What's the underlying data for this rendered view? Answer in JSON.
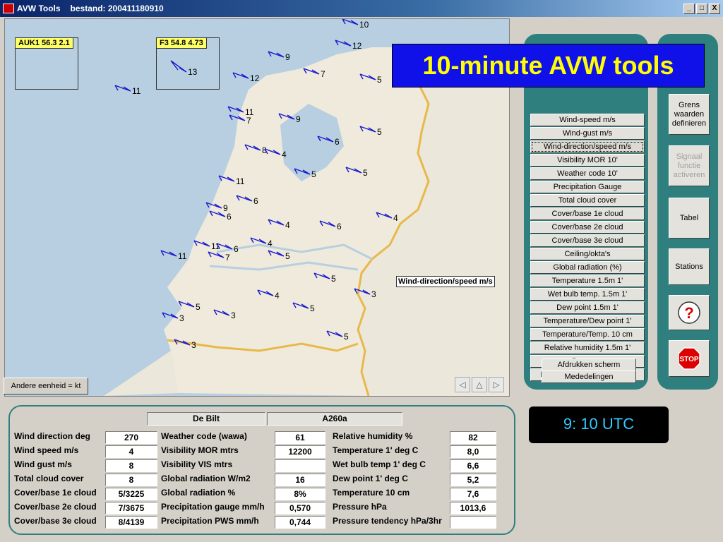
{
  "window": {
    "app_name": "AVW Tools",
    "subtitle": "bestand: 200411180910",
    "minimize": "_",
    "maximize": "□",
    "close": "X"
  },
  "banner": "10-minute AVW tools",
  "map": {
    "insets": [
      {
        "label": "AUK1 56.3 2.1"
      },
      {
        "label": "F3 54.8 4.73",
        "speed": "13"
      }
    ],
    "selected_parameter_label": "Wind-direction/speed m/s",
    "unit_button": "Andere eenheid = kt",
    "nav_buttons": [
      "◁",
      "△",
      "▷"
    ],
    "wind_speeds": [
      "10",
      "12",
      "9",
      "7",
      "5",
      "11",
      "12",
      "11",
      "7",
      "9",
      "6",
      "5",
      "8",
      "4",
      "11",
      "5",
      "5",
      "9",
      "6",
      "6",
      "4",
      "6",
      "4",
      "11",
      "11",
      "6",
      "7",
      "5",
      "4",
      "5",
      "3",
      "4",
      "5",
      "5",
      "3",
      "3",
      "5",
      "3"
    ]
  },
  "parameters": [
    "Wind-speed m/s",
    "Wind-gust m/s",
    "Wind-direction/speed m/s",
    "Visibility MOR 10'",
    "Weather code 10'",
    "Precipitation Gauge",
    "Total cloud cover",
    "Cover/base 1e cloud",
    "Cover/base 2e cloud",
    "Cover/base 3e cloud",
    "Ceiling/okta's",
    "Global radiation (%)",
    "Temperature 1.5m 1'",
    "Wet bulb temp. 1.5m 1'",
    "Dew point 1.5m 1'",
    "Temperature/Dew point 1'",
    "Temperature/Temp. 10 cm",
    "Relative humidity 1.5m 1'",
    "Pressure",
    "Pressure tendency hPa/3hr"
  ],
  "selected_parameter_index": 2,
  "bottom_buttons": [
    "Afdrukken scherm",
    "Mededelingen"
  ],
  "side_buttons": {
    "grens": "Grens\nwaarden\ndefinieren",
    "signaal": "Signaal\nfunctie\nactiveren",
    "tabel": "Tabel",
    "stations": "Stations",
    "help_glyph": "?",
    "stop_label": "STOP"
  },
  "clock": "9: 10 UTC",
  "station": {
    "name": "De Bilt",
    "code": "A260a"
  },
  "readings": {
    "col1": [
      {
        "label": "Wind direction deg",
        "value": "270"
      },
      {
        "label": "Wind speed m/s",
        "value": "4"
      },
      {
        "label": "Wind gust m/s",
        "value": "8"
      },
      {
        "label": "Total cloud cover",
        "value": "8"
      },
      {
        "label": "Cover/base 1e cloud",
        "value": "5/3225"
      },
      {
        "label": "Cover/base 2e cloud",
        "value": "7/3675"
      },
      {
        "label": "Cover/base 3e cloud",
        "value": "8/4139"
      }
    ],
    "col2": [
      {
        "label": "Weather code (wawa)",
        "value": "61"
      },
      {
        "label": "Visibility MOR mtrs",
        "value": "12200"
      },
      {
        "label": "Visibility VIS mtrs",
        "value": ""
      },
      {
        "label": "Global radiation W/m2",
        "value": "16"
      },
      {
        "label": "Global radiation %",
        "value": "8%"
      },
      {
        "label": "Precipitation gauge mm/h",
        "value": "0,570"
      },
      {
        "label": "Precipitation PWS mm/h",
        "value": "0,744"
      }
    ],
    "col3": [
      {
        "label": "Relative humidity %",
        "value": "82"
      },
      {
        "label": "Temperature 1' deg C",
        "value": "8,0"
      },
      {
        "label": "Wet bulb temp 1' deg C",
        "value": "6,6"
      },
      {
        "label": "Dew point 1' deg C",
        "value": "5,2"
      },
      {
        "label": "Temperature 10 cm",
        "value": "7,6"
      },
      {
        "label": "Pressure hPa",
        "value": "1013,6"
      },
      {
        "label": "Pressure tendency hPa/3hr",
        "value": ""
      }
    ]
  },
  "colors": {
    "panel": "#2f7f7f",
    "banner_bg": "#1010e8",
    "banner_text": "#ffff00",
    "arrow": "#1a1acc",
    "clock_text": "#33ccff",
    "border_line": "#e8b84a"
  }
}
